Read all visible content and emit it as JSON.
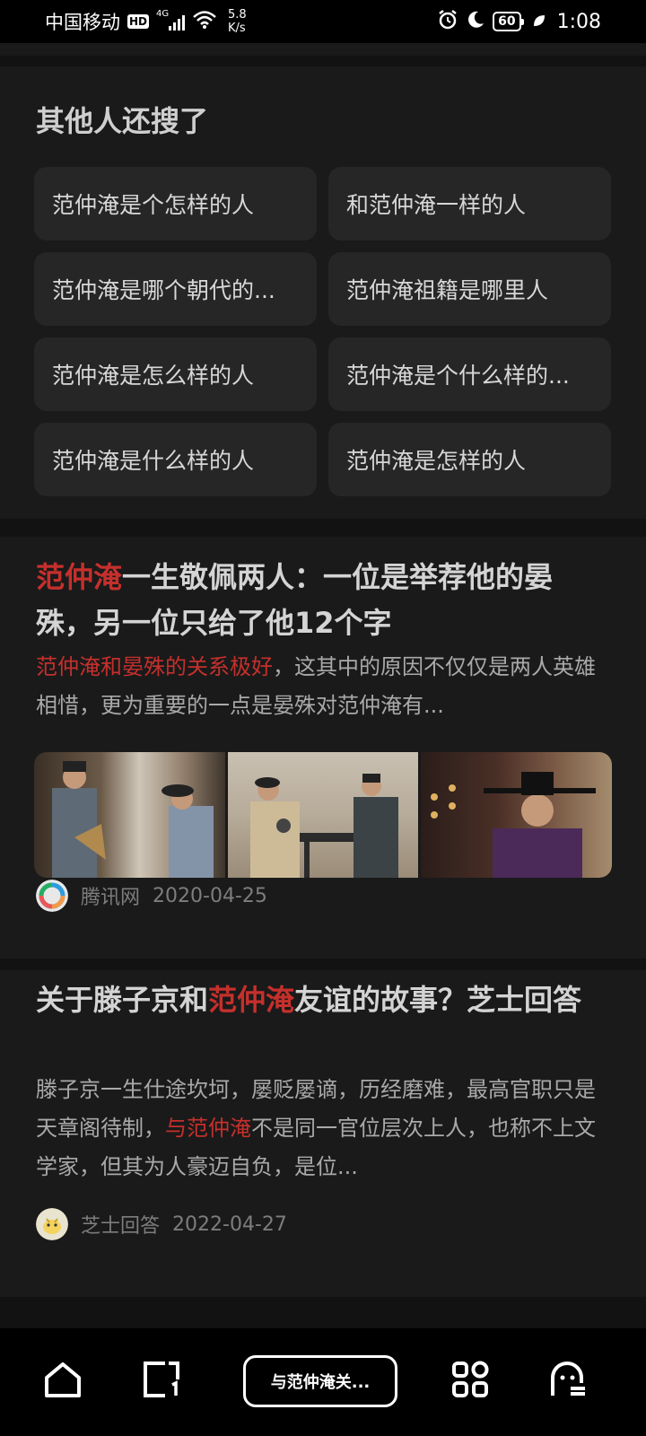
{
  "status_bar": {
    "carrier": "中国移动",
    "hd": "HD",
    "network": "4G",
    "speed_value": "5.8",
    "speed_unit": "K/s",
    "battery": "60",
    "time": "1:08"
  },
  "related_searches": {
    "title": "其他人还搜了",
    "items": [
      "范仲淹是个怎样的人",
      "和范仲淹一样的人",
      "范仲淹是哪个朝代的...",
      "范仲淹祖籍是哪里人",
      "范仲淹是怎么样的人",
      "范仲淹是个什么样的...",
      "范仲淹是什么样的人",
      "范仲淹是怎样的人"
    ]
  },
  "articles": [
    {
      "title_hl": "范仲淹",
      "title_rest": "一生敬佩两人：一位是举荐他的晏殊，另一位只给了他12个字",
      "desc_hl": "范仲淹和晏殊的关系极好",
      "desc_rest": "，这其中的原因不仅仅是两人英雄相惜，更为重要的一点是晏殊对范仲淹有...",
      "source": "腾讯网",
      "date": "2020-04-25"
    },
    {
      "title_pre": "关于滕子京和",
      "title_hl": "范仲淹",
      "title_post": "友谊的故事？芝士回答",
      "desc_pre": "滕子京一生仕途坎坷，屡贬屡谪，历经磨难，最高官职只是天章阁待制，",
      "desc_hl": "与范仲淹",
      "desc_post": "不是同一官位层次上人，也称不上文学家，但其为人豪迈自负，是位...",
      "source": "芝士回答",
      "date": "2022-04-27"
    }
  ],
  "bottom_nav": {
    "query_label": "与范仲淹关...",
    "icons": [
      "home-icon",
      "tabs-icon",
      "apps-icon",
      "profile-icon"
    ]
  },
  "colors": {
    "highlight": "#c5302c",
    "card_bg": "#1a1a1a",
    "page_bg": "#121212"
  }
}
